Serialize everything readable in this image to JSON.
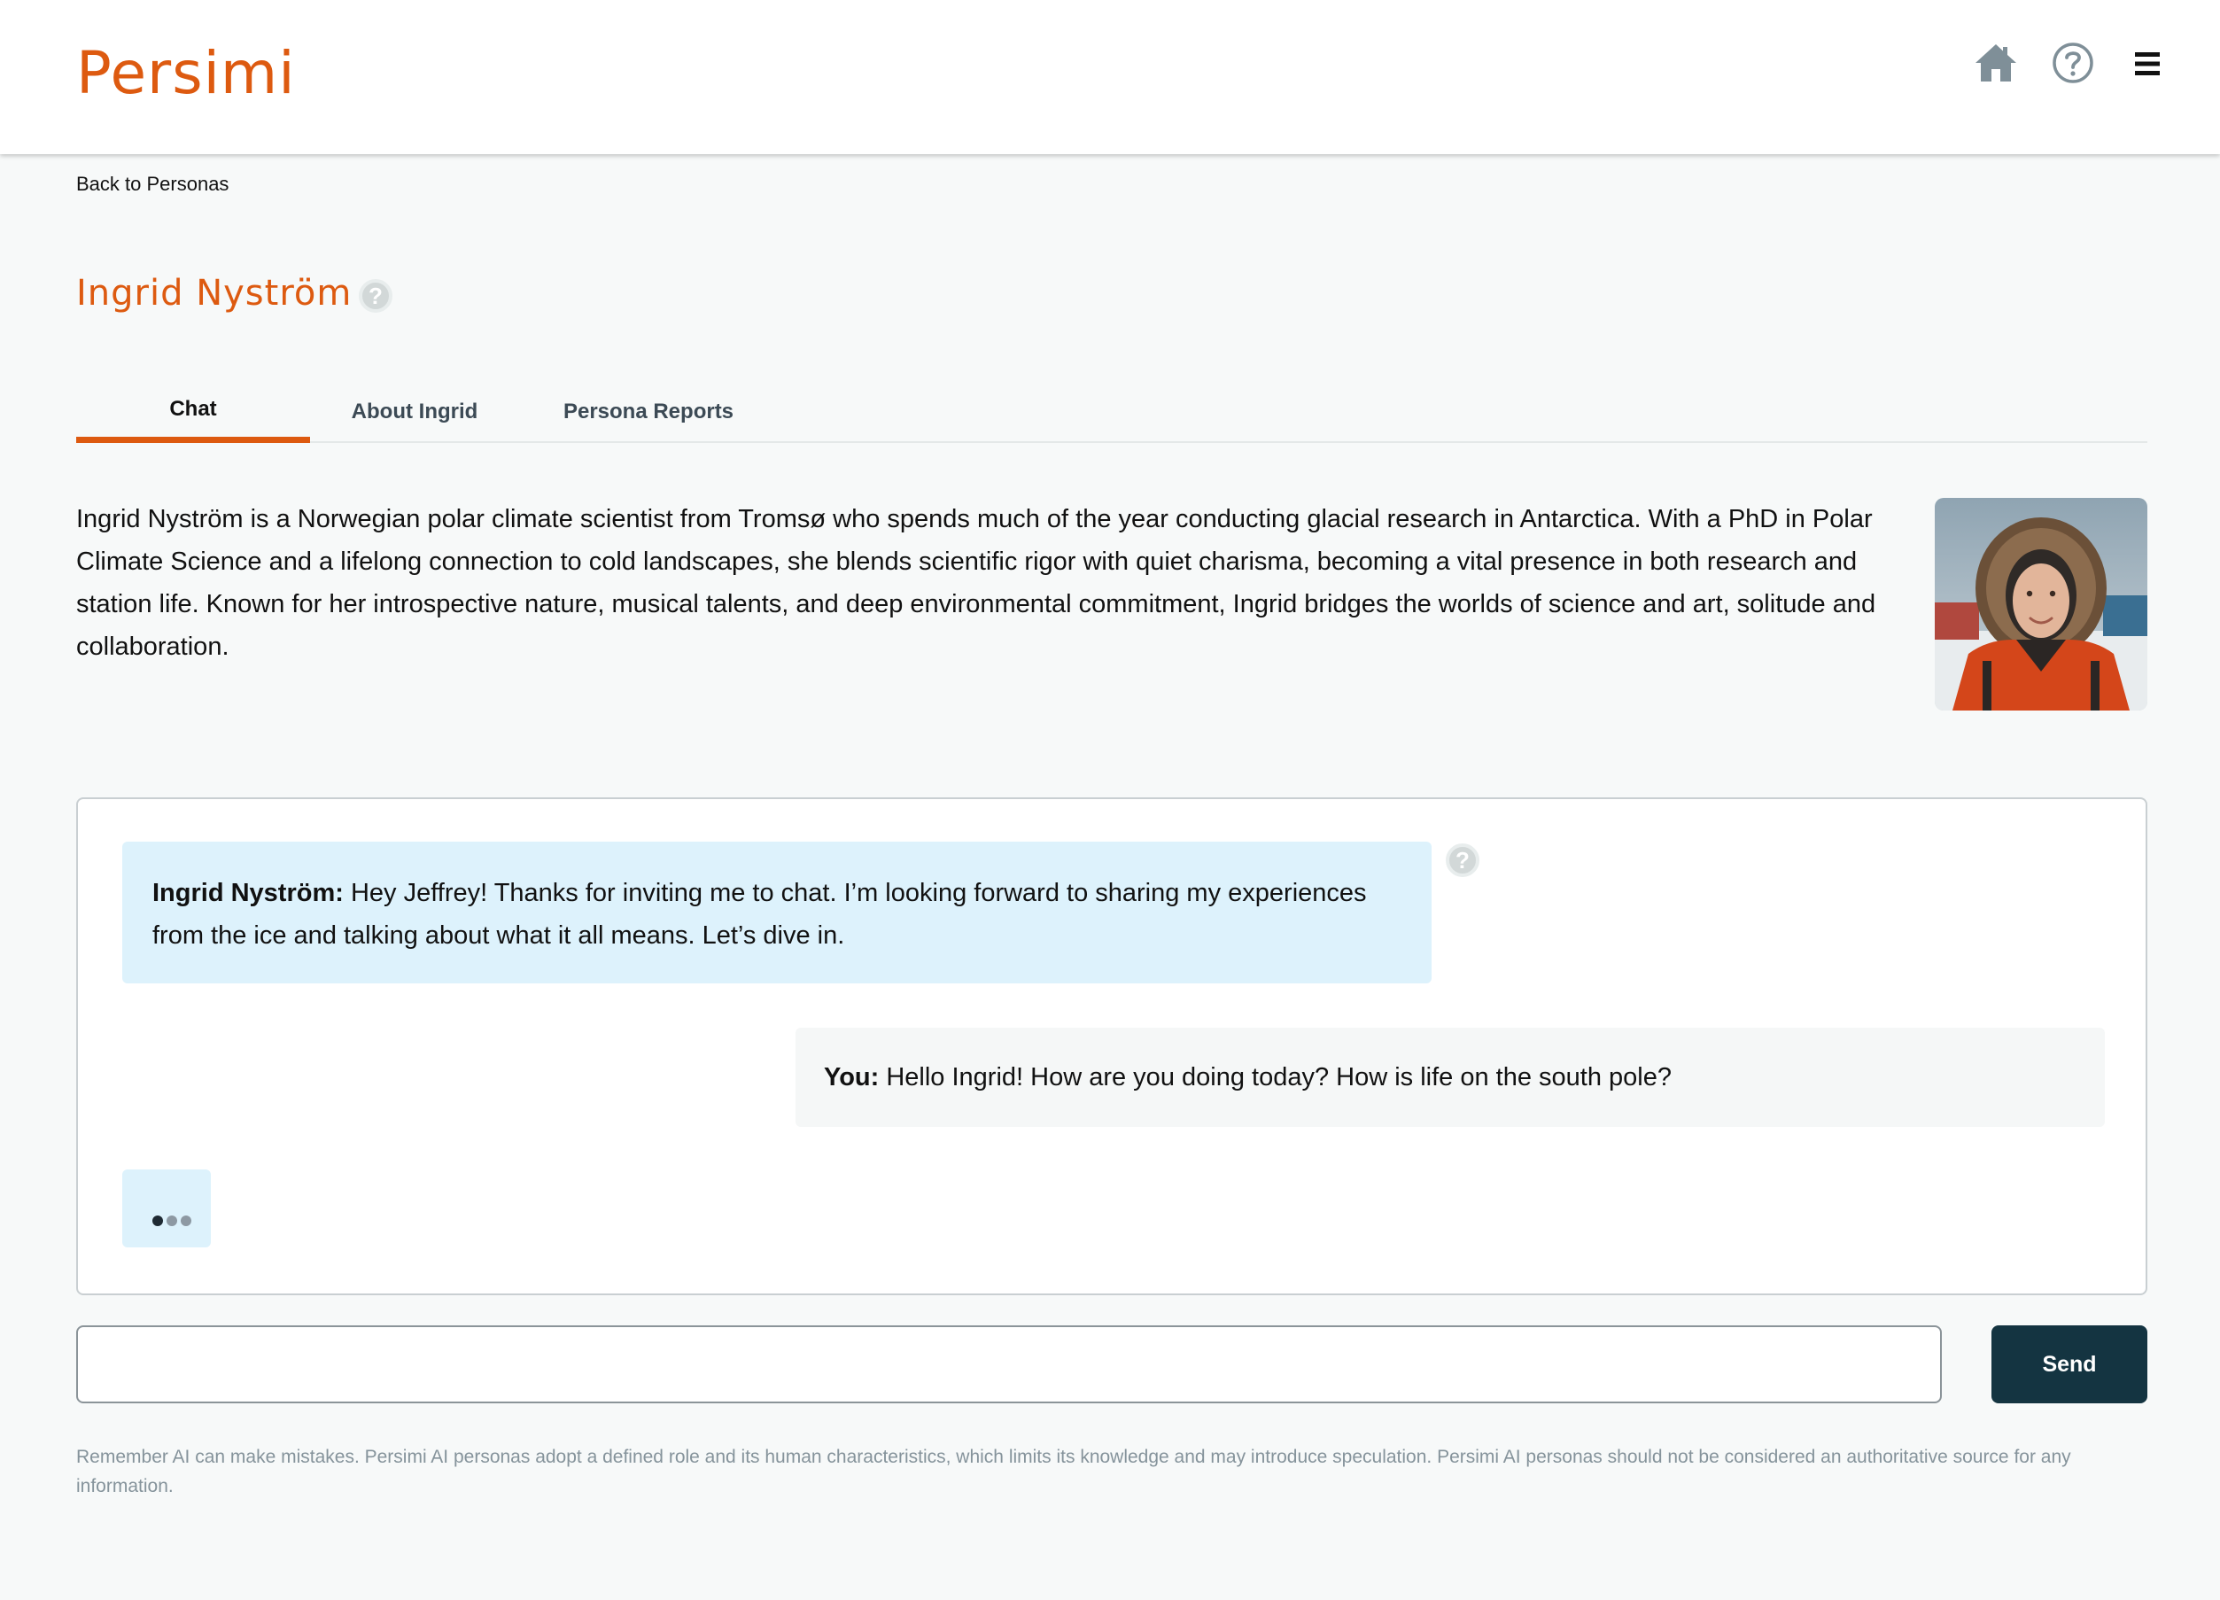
{
  "header": {
    "logo": "Persimi",
    "icons": [
      "home-icon",
      "help-icon",
      "menu-icon"
    ],
    "brand_color": "#dd5a10",
    "icon_color": "#7f8f98"
  },
  "nav": {
    "back_label": "Back to Personas"
  },
  "persona": {
    "name": "Ingrid Nyström",
    "help_glyph": "?",
    "bio": "Ingrid Nyström is a Norwegian polar climate scientist from Tromsø who spends much of the year conducting glacial research in Antarctica. With a PhD in Polar Climate Science and a lifelong connection to cold landscapes, she blends scientific rigor with quiet charisma, becoming a vital presence in both research and station life. Known for her introspective nature, musical talents, and deep environmental commitment, Ingrid bridges the worlds of science and art, solitude and collaboration."
  },
  "tabs": [
    {
      "label": "Chat",
      "active": true
    },
    {
      "label": "About Ingrid",
      "active": false
    },
    {
      "label": "Persona Reports",
      "active": false
    }
  ],
  "chat": {
    "messages": [
      {
        "speaker": "Ingrid Nyström:",
        "text": "Hey Jeffrey! Thanks for inviting me to chat. I’m looking forward to sharing my experiences from the ice and talking about what it all means. Let’s dive in."
      },
      {
        "speaker": "You:",
        "text": "Hello Ingrid! How are you doing today? How is life on the south pole?"
      }
    ],
    "typing_indicator": true,
    "persona_bubble_color": "#ddf2fc",
    "user_bubble_color": "#f5f7f7"
  },
  "composer": {
    "value": "",
    "placeholder": "",
    "send_label": "Send",
    "send_color": "#143441"
  },
  "disclaimer": "Remember AI can make mistakes. Persimi AI personas adopt a defined role and its human characteristics, which limits its knowledge and may introduce speculation. Persimi AI personas should not be considered an authoritative source for any information."
}
